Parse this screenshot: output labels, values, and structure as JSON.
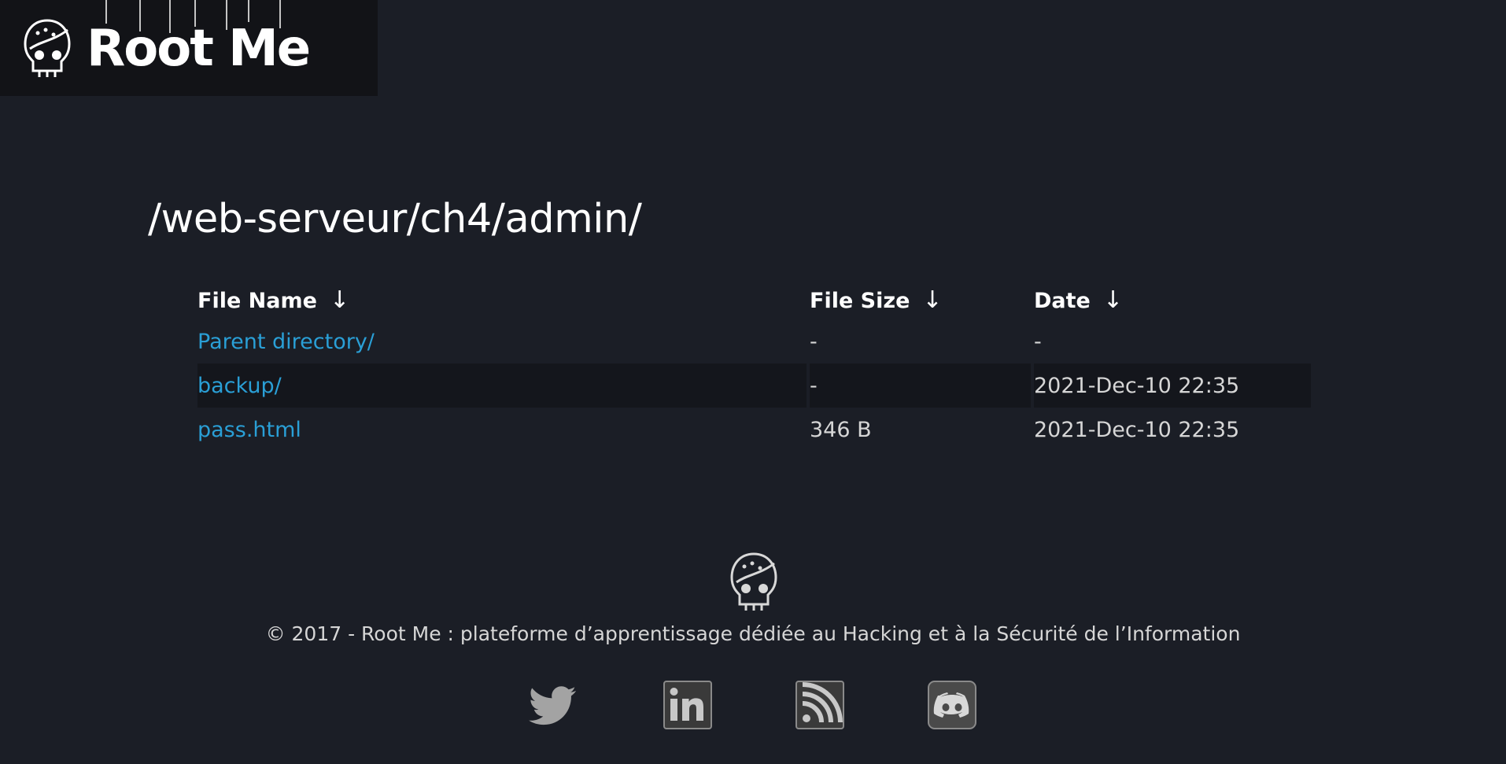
{
  "header": {
    "logo_text": "Root Me"
  },
  "page": {
    "title": "/web-serveur/ch4/admin/"
  },
  "listing": {
    "columns": [
      {
        "label": "File Name",
        "sort_icon": "↓"
      },
      {
        "label": "File Size",
        "sort_icon": "↓"
      },
      {
        "label": "Date",
        "sort_icon": "↓"
      }
    ],
    "rows": [
      {
        "name": "Parent directory/",
        "size": "-",
        "date": "-"
      },
      {
        "name": "backup/",
        "size": "-",
        "date": "2021-Dec-10 22:35"
      },
      {
        "name": "pass.html",
        "size": "346 B",
        "date": "2021-Dec-10 22:35"
      }
    ]
  },
  "footer": {
    "copyright": "© 2017 - Root Me : plateforme d’apprentissage dédiée au Hacking et à la Sécurité de l’Information",
    "social": [
      {
        "name": "twitter-icon"
      },
      {
        "name": "linkedin-icon"
      },
      {
        "name": "rss-icon"
      },
      {
        "name": "discord-icon"
      }
    ]
  },
  "colors": {
    "background": "#1b1e26",
    "header_bg": "#121317",
    "link": "#2a9fd6",
    "row_alt": "#14161c"
  }
}
